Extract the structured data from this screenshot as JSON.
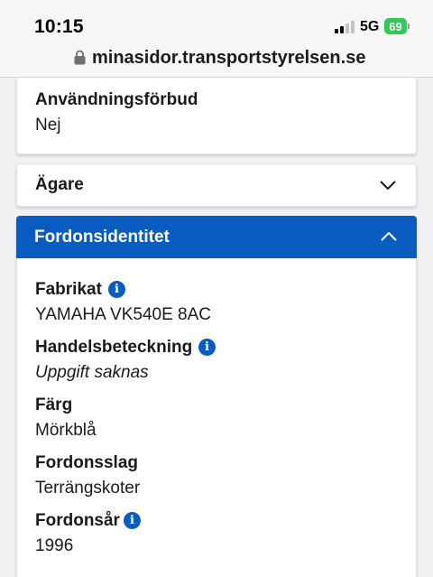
{
  "status_bar": {
    "time": "10:15",
    "network": "5G",
    "battery": "69",
    "battery_color": "#34c759"
  },
  "url_bar": {
    "url": "minasidor.transportstyrelsen.se",
    "lock_icon": "lock-icon"
  },
  "top_card": {
    "label": "Användningsförbud",
    "value": "Nej"
  },
  "agare": {
    "title": "Ägare",
    "icon": "chevron-down-icon"
  },
  "fordonsidentitet": {
    "title": "Fordonsidentitet",
    "header_color": "#0a5cc0",
    "icon": "chevron-up-icon",
    "fields": [
      {
        "label": "Fabrikat",
        "value": "YAMAHA VK540E 8AC",
        "info": "i"
      },
      {
        "label": "Handelsbeteckning",
        "value": "Uppgift saknas",
        "info": "i"
      },
      {
        "label": "Färg",
        "value": "Mörkblå"
      },
      {
        "label": "Fordonsslag",
        "value": "Terrängskoter"
      },
      {
        "label": "Fordonsår",
        "value": "1996",
        "info": "i"
      }
    ]
  }
}
